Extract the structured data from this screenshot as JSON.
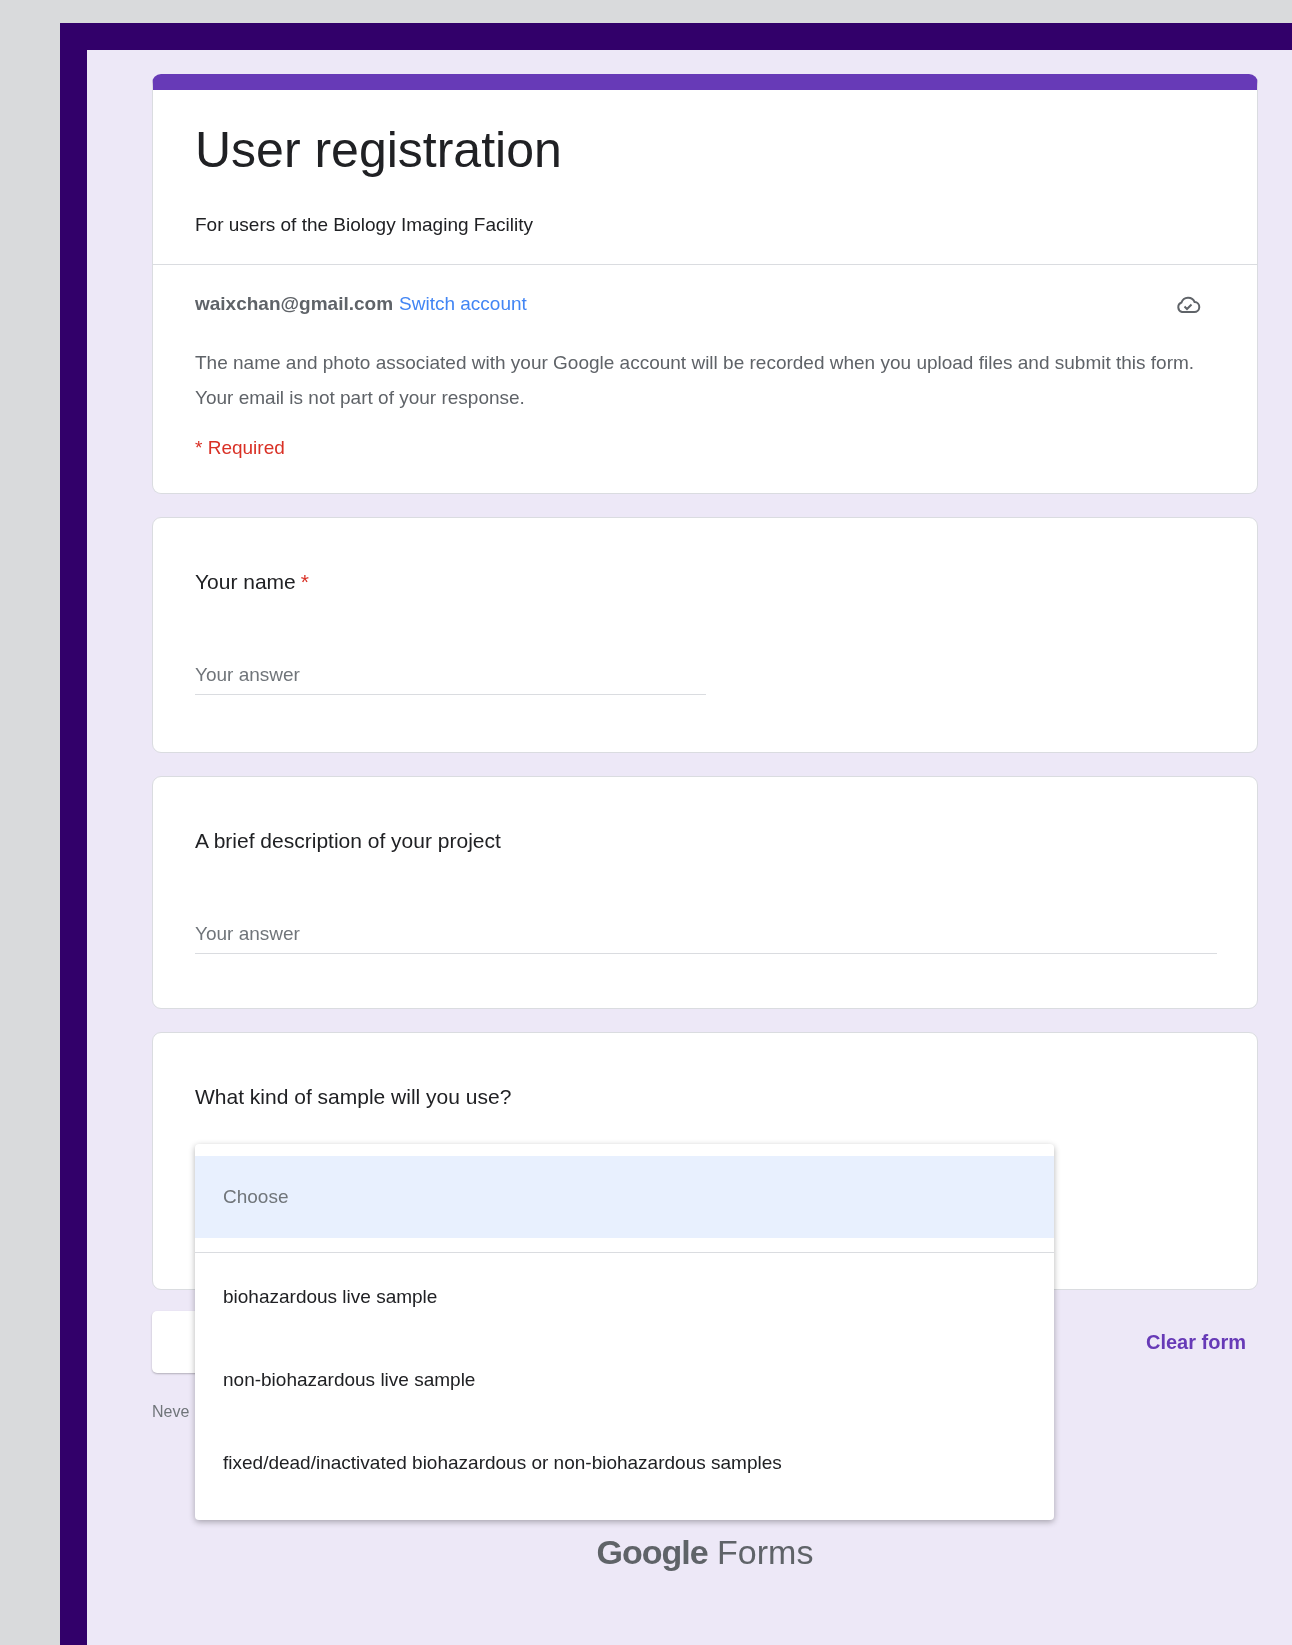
{
  "form": {
    "title": "User registration",
    "description": "For users of the Biology Imaging Facility"
  },
  "account": {
    "email": "waixchan@gmail.com",
    "switch_link": "Switch account",
    "notice": "The name and photo associated with your Google account will be recorded when you upload files and submit this form. Your email is not part of your response.",
    "required_note": "* Required"
  },
  "questions": [
    {
      "kind": "short_answer",
      "title": "Your name",
      "required_mark": "*",
      "placeholder": "Your answer"
    },
    {
      "kind": "paragraph",
      "title": "A brief description of your project",
      "placeholder": "Your answer"
    },
    {
      "kind": "dropdown",
      "title": "What kind of sample will you use?"
    }
  ],
  "dropdown_menu": {
    "options": [
      {
        "label": "Choose",
        "selected": true
      },
      {
        "label": "biohazardous live sample",
        "selected": false
      },
      {
        "label": "non-biohazardous live sample",
        "selected": false
      },
      {
        "label": "fixed/dead/inactivated biohazardous or non-biohazardous samples",
        "selected": false
      }
    ]
  },
  "footer": {
    "clear_button": "Clear form",
    "notice_fragment": "Neve",
    "brand": "Google",
    "product": "Forms"
  }
}
